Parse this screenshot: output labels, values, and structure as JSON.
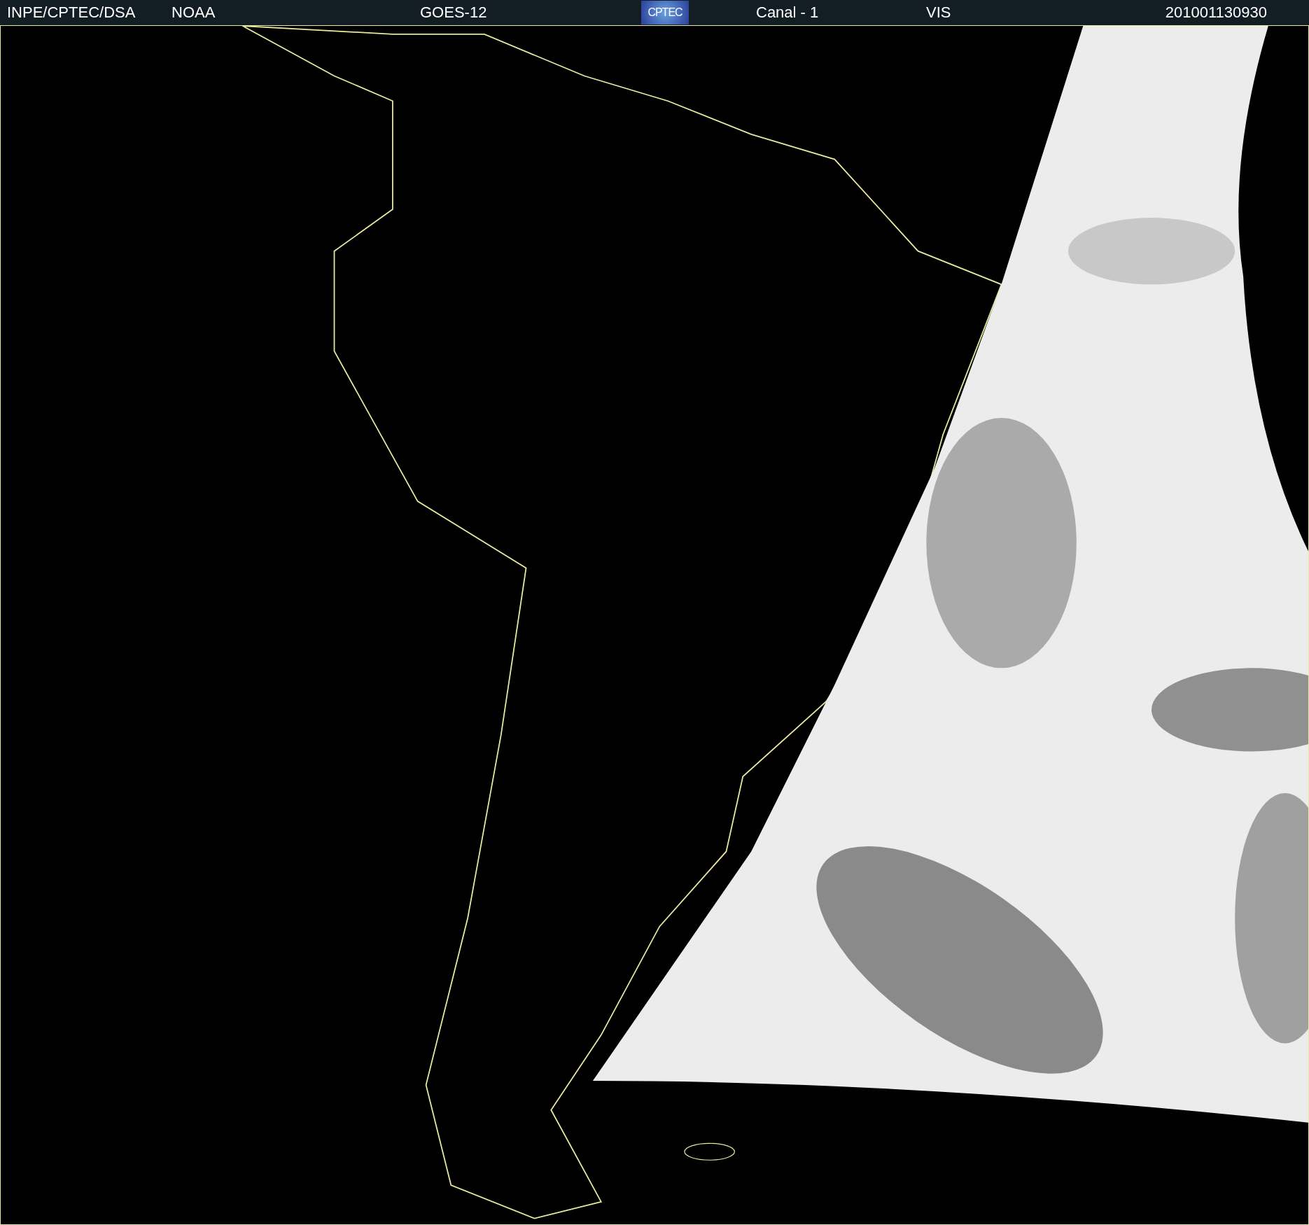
{
  "header": {
    "items": [
      {
        "kind": "text",
        "text": "INPE/CPTEC/DSA"
      },
      {
        "kind": "text",
        "text": "NOAA"
      },
      {
        "kind": "text",
        "text": "GOES-12"
      },
      {
        "kind": "logo",
        "text": "CPTEC"
      },
      {
        "kind": "text",
        "text": "Canal - 1"
      },
      {
        "kind": "text",
        "text": "VIS"
      },
      {
        "kind": "text",
        "text": "201001130930"
      }
    ]
  }
}
